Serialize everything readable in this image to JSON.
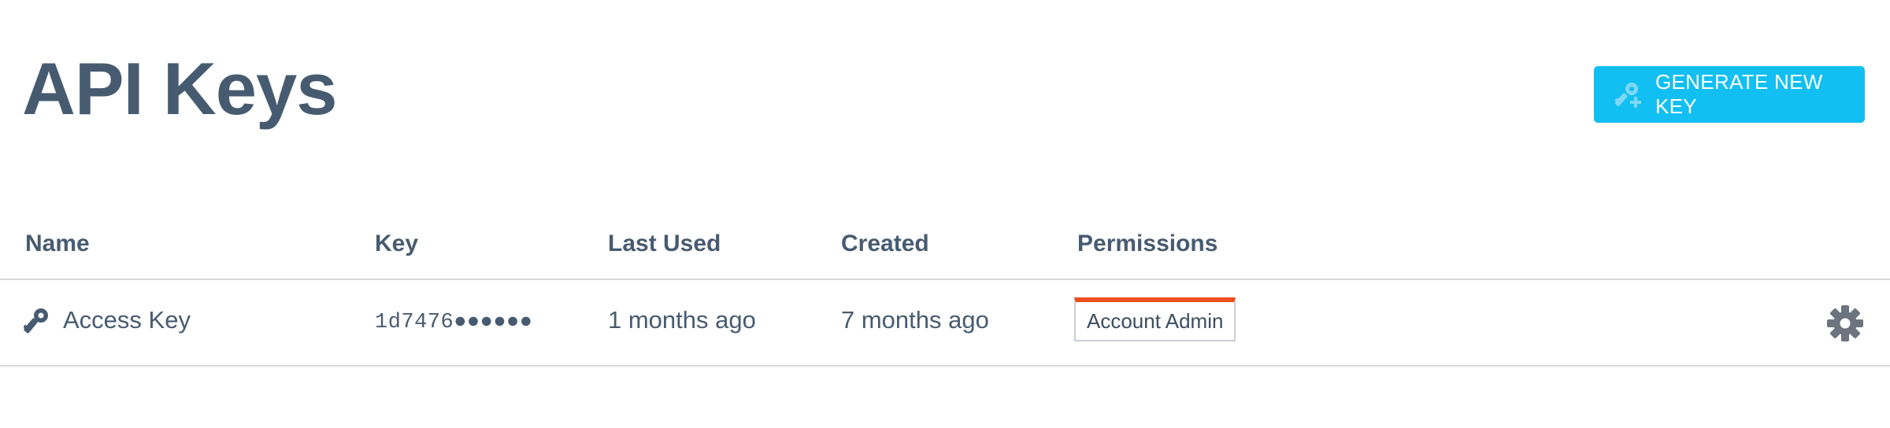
{
  "page": {
    "title": "API Keys"
  },
  "toolbar": {
    "generate_label": "GENERATE NEW KEY",
    "generate_icon": "key-plus-icon"
  },
  "table": {
    "columns": [
      "Name",
      "Key",
      "Last Used",
      "Created",
      "Permissions"
    ],
    "rows": [
      {
        "icon": "key-icon",
        "name": "Access Key",
        "key": "1d7476●●●●●●",
        "last_used": "1 months ago",
        "created": "7 months ago",
        "permission": "Account Admin",
        "settings_icon": "gear-icon"
      }
    ]
  },
  "colors": {
    "text": "#475b70",
    "accent": "#12bff2",
    "badge_top": "#ec4e1e",
    "divider": "#d6d9dd"
  }
}
